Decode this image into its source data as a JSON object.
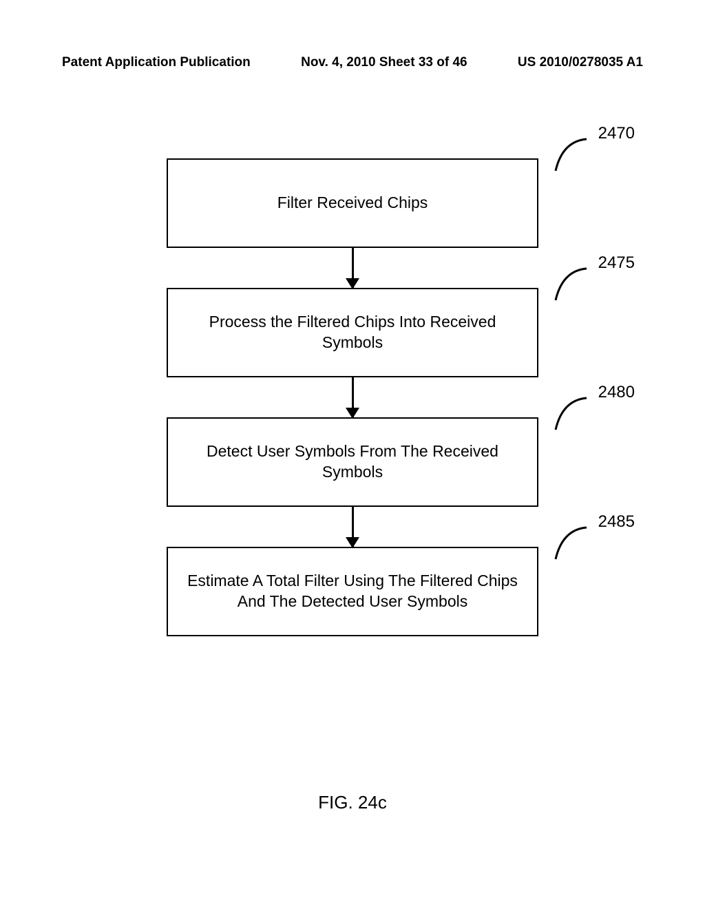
{
  "header": {
    "left": "Patent Application Publication",
    "center": "Nov. 4, 2010  Sheet 33 of 46",
    "right": "US 2010/0278035 A1"
  },
  "boxes": [
    {
      "text": "Filter Received Chips",
      "label": "2470"
    },
    {
      "text": "Process the Filtered Chips Into Received Symbols",
      "label": "2475"
    },
    {
      "text": "Detect User Symbols From The Received Symbols",
      "label": "2480"
    },
    {
      "text": "Estimate A Total Filter Using The Filtered Chips And The Detected User Symbols",
      "label": "2485"
    }
  ],
  "caption": "FIG. 24c"
}
